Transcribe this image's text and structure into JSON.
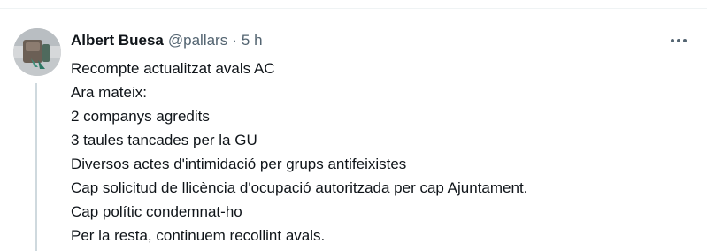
{
  "tweet": {
    "author": {
      "display_name": "Albert Buesa",
      "handle": "@pallars",
      "separator": "·",
      "time": "5 h"
    },
    "more_icon": "more-horizontal-icon",
    "lines": [
      "Recompte actualitzat avals AC",
      "Ara mateix:",
      "2 companys agredits",
      "3 taules tancades per la GU",
      "Diversos actes d'intimidació per grups antifeixistes",
      "Cap solicitud de llicència d'ocupació autoritzada per cap Ajuntament.",
      "Cap polític condemnat-ho",
      "Per la resta, continuem recollint avals."
    ]
  },
  "colors": {
    "text_primary": "#0f1419",
    "text_secondary": "#536471",
    "thread_line": "#cfd9de",
    "divider": "#eff3f4"
  }
}
